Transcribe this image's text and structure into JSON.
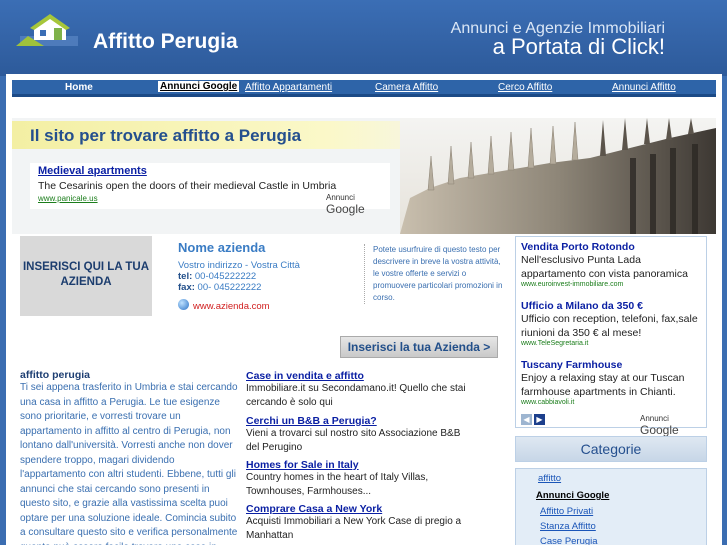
{
  "site": {
    "name": "Affitto Perugia",
    "tagline_line1": "Annunci e Agenzie Immobiliari",
    "tagline_line2": "a Portata di Click!"
  },
  "nav": {
    "items": [
      "Home",
      "Annunci Google",
      "Affitto Appartamenti",
      "Camera Affitto",
      "Cerco Affitto",
      "Annunci Affitto"
    ]
  },
  "hero": {
    "title": "Il sito per trovare affitto a Perugia",
    "ad": {
      "title": "Medieval apartments",
      "desc": "The Cesarinis open the doors of their medieval Castle in Umbria",
      "url": "www.panicale.us"
    },
    "ads_by_label": "Annunci",
    "ads_by_brand": "Google"
  },
  "insert_box": {
    "text": "INSERISCI QUI LA TUA AZIENDA"
  },
  "company": {
    "name": "Nome azienda",
    "address": "Vostro indirizzo - Vostra Città",
    "tel_label": "tel:",
    "tel": "00-045222222",
    "fax_label": "fax:",
    "fax": "00- 045222222",
    "website": "www.azienda.com"
  },
  "promo": {
    "text": "Potete usurfruire di questo testo per descrivere in breve la vostra attività, le vostre offerte e servizi o promuovere particolari promozioni in corso."
  },
  "insert_button": {
    "label": "Inserisci la tua Azienda >"
  },
  "right_ads": [
    {
      "title": "Vendita Porto Rotondo",
      "desc": "Nell'esclusivo Punta Lada appartamento con vista panoramica",
      "url": "www.euroinvest-immobiliare.com"
    },
    {
      "title": "Ufficio a Milano da 350 €",
      "desc": "Ufficio con reception, telefoni, fax,sale riunioni da 350 € al mese!",
      "url": "www.TeleSegretaria.it"
    },
    {
      "title": "Tuscany Farmhouse",
      "desc": "Enjoy a relaxing stay at our Tuscan farmhouse apartments in Chianti.",
      "url": "www.cabbiavoli.it"
    }
  ],
  "right_ads_footer": {
    "label": "Annunci",
    "brand": "Google"
  },
  "categorie": {
    "title": "Categorie",
    "items": [
      "affitto",
      "Annunci Google",
      "Affitto Privati",
      "Stanza Affitto",
      "Case Perugia"
    ]
  },
  "article": {
    "title": "affitto perugia",
    "body": "Ti sei appena trasferito in Umbria e stai cercando una casa in affitto a Perugia. Le tue esigenze sono prioritarie, e vorresti trovare un appartamento in affitto al centro di Perugia, non lontano dall'università. Vorresti anche non dover spendere troppo, magari dividendo l'appartamento con altri studenti. Ebbene, tutti gli annunci che stai cercando sono presenti in questo sito, e grazie alla vastissima scelta puoi optare per una soluzione ideale. Comincia subito a consultare questo sito e verifica personalmente quanto può essere facile trovare una casa in affitto a Perugia."
  },
  "mid_ads": [
    {
      "title": "Case in vendita e affitto",
      "desc": "Immobiliare.it su Secondamano.it! Quello che stai cercando è solo qui"
    },
    {
      "title": "Cerchi un B&B a Perugia?",
      "desc": "Vieni a trovarci sul nostro sito Associazione B&B del Perugino"
    },
    {
      "title": "Homes for Sale in Italy",
      "desc": "Country homes in the heart of Italy Villas, Townhouses, Farmhouses..."
    },
    {
      "title": "Comprare Casa a New York",
      "desc": "Acquisti Immobiliari a New York Case di pregio a Manhattan"
    }
  ]
}
